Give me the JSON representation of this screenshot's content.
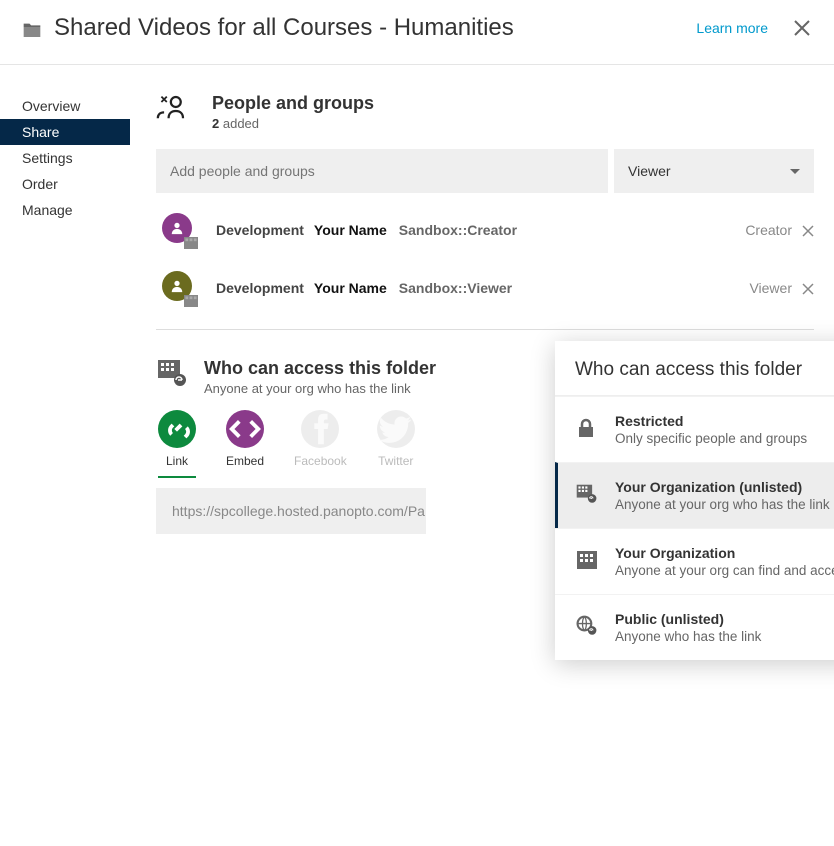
{
  "header": {
    "title": "Shared Videos for all Courses - Humanities",
    "learn_more": "Learn more"
  },
  "sidebar": {
    "items": [
      {
        "label": "Overview"
      },
      {
        "label": "Share"
      },
      {
        "label": "Settings"
      },
      {
        "label": "Order"
      },
      {
        "label": "Manage"
      }
    ],
    "active_index": 1
  },
  "people_section": {
    "title": "People and groups",
    "count": "2",
    "count_label": "added",
    "add_placeholder": "Add people and groups",
    "role_selected": "Viewer",
    "rows": [
      {
        "org": "Development",
        "name": "Your Name",
        "system": "Sandbox::Creator",
        "role": "Creator",
        "color": "purple"
      },
      {
        "org": "Development",
        "name": "Your Name",
        "system": "Sandbox::Viewer",
        "role": "Viewer",
        "color": "olive"
      }
    ]
  },
  "access_section": {
    "title": "Who can access this folder",
    "subtitle": "Anyone at your org who has the link",
    "share_methods": [
      {
        "label": "Link",
        "color": "green",
        "active": true
      },
      {
        "label": "Embed",
        "color": "purple",
        "active": false
      },
      {
        "label": "Facebook",
        "color": "gray",
        "muted": true
      },
      {
        "label": "Twitter",
        "color": "gray",
        "muted": true
      }
    ],
    "link_value": "https://spcollege.hosted.panopto.com/Pa"
  },
  "popover": {
    "title": "Who can access this folder",
    "selected_index": 1,
    "options": [
      {
        "label": "Restricted",
        "sub": "Only specific people and groups",
        "icon": "lock"
      },
      {
        "label": "Your Organization (unlisted)",
        "sub": "Anyone at your org who has the link",
        "icon": "org-link"
      },
      {
        "label": "Your Organization",
        "sub": "Anyone at your org can find and access",
        "icon": "org"
      },
      {
        "label": "Public (unlisted)",
        "sub": "Anyone who has the link",
        "icon": "globe-link"
      }
    ]
  }
}
